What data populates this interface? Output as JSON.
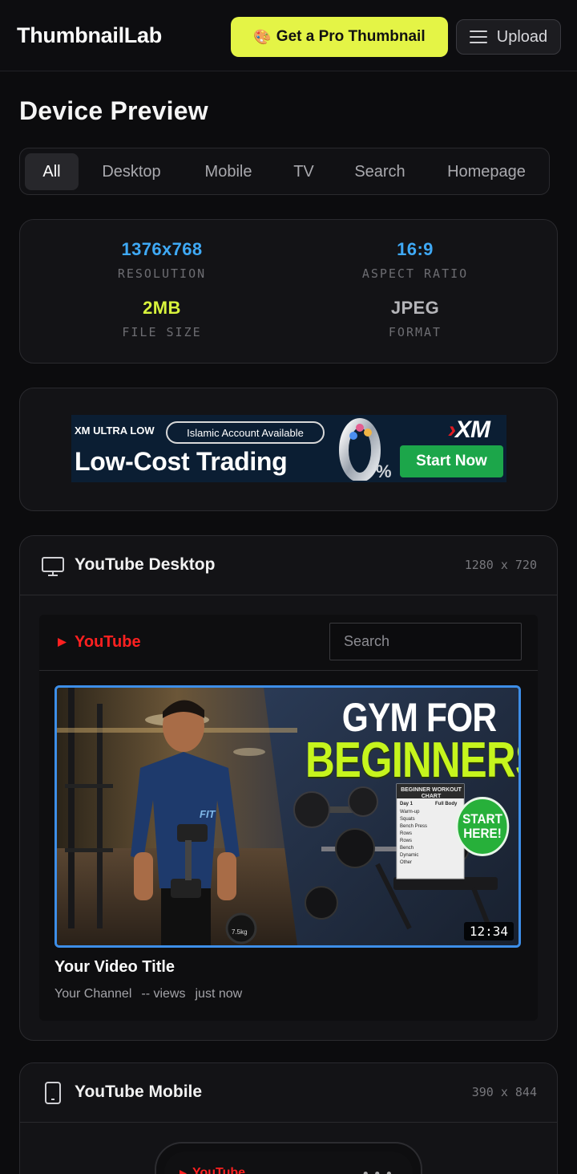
{
  "header": {
    "logo": "ThumbnailLab",
    "pro_button": "Get a Pro Thumbnail",
    "upload_button": "Upload"
  },
  "page_title": "Device Preview",
  "tabs": [
    {
      "label": "All",
      "active": true
    },
    {
      "label": "Desktop",
      "active": false
    },
    {
      "label": "Mobile",
      "active": false
    },
    {
      "label": "TV",
      "active": false
    },
    {
      "label": "Search",
      "active": false
    },
    {
      "label": "Homepage",
      "active": false
    }
  ],
  "stats": {
    "resolution": {
      "value": "1376x768",
      "label": "RESOLUTION",
      "color": "#3fa9f5"
    },
    "aspect": {
      "value": "16:9",
      "label": "ASPECT RATIO",
      "color": "#3fa9f5"
    },
    "filesize": {
      "value": "2MB",
      "label": "FILE SIZE",
      "color": "#d8f33c"
    },
    "format": {
      "value": "JPEG",
      "label": "FORMAT",
      "color": "#b5b5b9"
    }
  },
  "ad": {
    "small_text": "XM ULTRA LOW",
    "pill_text": "Islamic Account Available",
    "big_text": "Low-Cost Trading",
    "brand": "XM",
    "cta": "Start Now"
  },
  "desktop": {
    "title": "YouTube Desktop",
    "dims": "1280 x 720",
    "yt_logo": "YouTube",
    "search_placeholder": "Search",
    "thumbnail": {
      "line1": "GYM FOR",
      "line2": "BEGINNERS",
      "chart_title": "BEGINNER WORKOUT CHART",
      "chart_col1": "Day 1",
      "chart_col2": "Full Body",
      "chart_rows": [
        "Warm-up",
        "Squats",
        "Bench Press",
        "Rows",
        "Rows",
        "Bench",
        "Dynamic",
        "Other"
      ],
      "badge_line1": "START",
      "badge_line2": "HERE!",
      "shirt_logo": "FIT",
      "weight_label": "7.5kg",
      "duration": "12:34"
    },
    "video_title": "Your Video Title",
    "channel": "Your Channel",
    "views": "-- views",
    "time": "just now"
  },
  "mobile": {
    "title": "YouTube Mobile",
    "dims": "390 x 844",
    "yt_logo": "YouTube"
  }
}
